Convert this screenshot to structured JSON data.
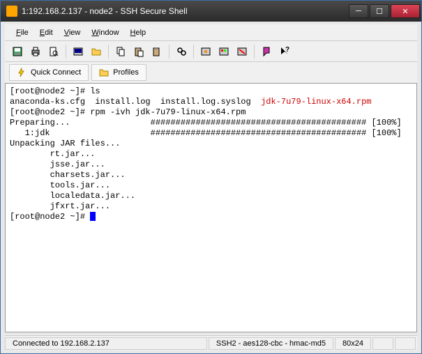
{
  "titlebar": {
    "text": "1:192.168.2.137 - node2 - SSH Secure Shell"
  },
  "menu": {
    "file": "File",
    "edit": "Edit",
    "view": "View",
    "window": "Window",
    "help": "Help"
  },
  "profilebar": {
    "quick_connect": "Quick Connect",
    "profiles": "Profiles"
  },
  "terminal": {
    "l1_prompt": "[root@node2 ~]# ",
    "l1_cmd": "ls",
    "l2_files": "anaconda-ks.cfg  install.log  install.log.syslog  ",
    "l2_red": "jdk-7u79-linux-x64.rpm",
    "l3_prompt": "[root@node2 ~]# ",
    "l3_cmd": "rpm -ivh jdk-7u79-linux-x64.rpm",
    "l4": "Preparing...                ########################################### [100%]",
    "l5": "   1:jdk                    ########################################### [100%]",
    "l6": "Unpacking JAR files...",
    "l7": "        rt.jar...",
    "l8": "        jsse.jar...",
    "l9": "        charsets.jar...",
    "l10": "        tools.jar...",
    "l11": "        localedata.jar...",
    "l12": "        jfxrt.jar...",
    "l13_prompt": "[root@node2 ~]# "
  },
  "statusbar": {
    "connected": "Connected to 192.168.2.137",
    "cipher": "SSH2 - aes128-cbc - hmac-md5",
    "size": "80x24"
  },
  "icons": {
    "save": "save-icon",
    "print": "print-icon",
    "preview": "preview-icon",
    "new": "new-icon",
    "open": "open-icon",
    "copy": "copy-icon",
    "paste": "paste-icon",
    "cut": "cut-icon",
    "find": "find-icon",
    "settings": "settings-icon",
    "colors": "colors-icon",
    "disconnect": "disconnect-icon",
    "help": "help-icon",
    "whatsthis": "whatsthis-icon"
  }
}
